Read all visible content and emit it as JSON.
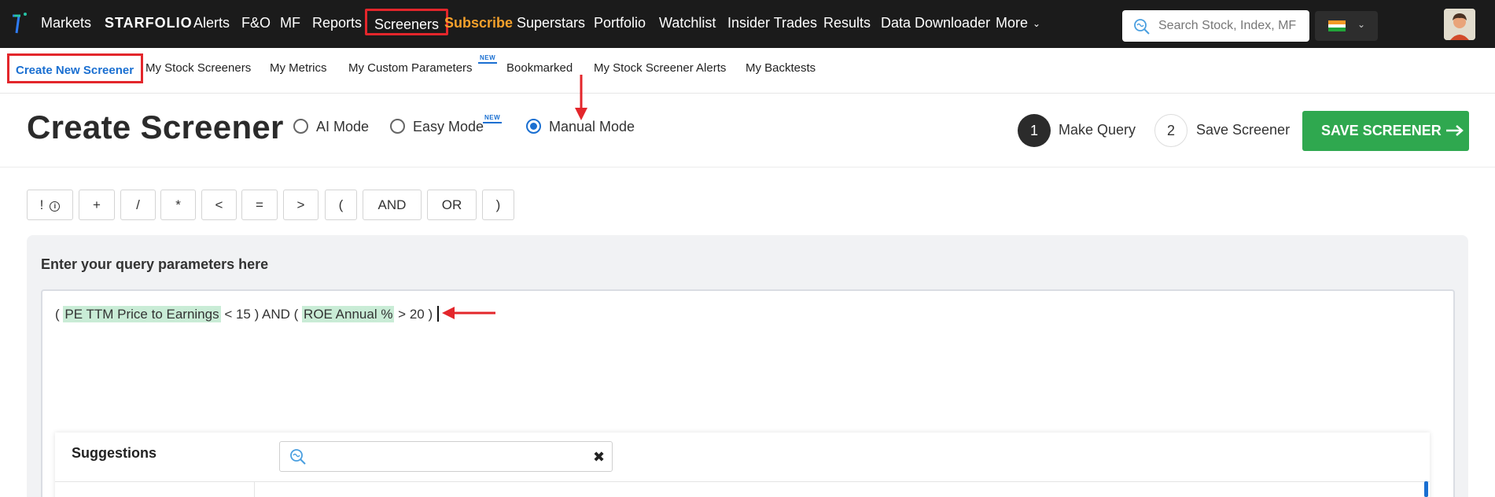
{
  "topnav": {
    "items": [
      {
        "label": "Markets"
      },
      {
        "label": "STARFOLIO"
      },
      {
        "label": "Alerts"
      },
      {
        "label": "F&O"
      },
      {
        "label": "MF"
      },
      {
        "label": "Reports"
      },
      {
        "label": "Screeners"
      },
      {
        "label": "Subscribe"
      },
      {
        "label": "Superstars"
      },
      {
        "label": "Portfolio"
      },
      {
        "label": "Watchlist"
      },
      {
        "label": "Insider Trades"
      },
      {
        "label": "Results"
      },
      {
        "label": "Data Downloader"
      },
      {
        "label": "More"
      }
    ],
    "search_placeholder": "Search Stock, Index, MF",
    "accent_subscribe": "#f5a12b"
  },
  "subnav": {
    "items": [
      {
        "label": "Create New Screener"
      },
      {
        "label": "My Stock Screeners"
      },
      {
        "label": "My Metrics"
      },
      {
        "label": "My Custom Parameters"
      },
      {
        "label": "Bookmarked"
      },
      {
        "label": "My Stock Screener Alerts"
      },
      {
        "label": "My Backtests"
      }
    ],
    "new_badge": "NEW"
  },
  "header": {
    "title": "Create Screener",
    "modes": [
      {
        "label": "AI Mode",
        "selected": false
      },
      {
        "label": "Easy Mode",
        "selected": false
      },
      {
        "label": "Manual Mode",
        "selected": true
      }
    ],
    "new_badge": "NEW",
    "steps": [
      {
        "number": "1",
        "label": "Make Query"
      },
      {
        "number": "2",
        "label": "Save Screener"
      }
    ],
    "save_button": "SAVE SCREENER"
  },
  "operators": [
    "!",
    "+",
    "/",
    "*",
    "<",
    "=",
    ">",
    "(",
    "AND",
    "OR",
    ")"
  ],
  "query": {
    "panel_title": "Enter your query parameters here",
    "tokens": [
      {
        "text": "( ",
        "highlight": false
      },
      {
        "text": "PE TTM Price to Earnings",
        "highlight": true
      },
      {
        "text": " < 15 ) AND ( ",
        "highlight": false
      },
      {
        "text": "ROE Annual %",
        "highlight": true
      },
      {
        "text": " > 20 )",
        "highlight": false
      }
    ]
  },
  "suggestions": {
    "title": "Suggestions",
    "search_value": ""
  },
  "colors": {
    "nav_bg": "#1b1b1b",
    "primary_blue": "#1a6fd1",
    "save_green": "#2fa84f",
    "annotation_red": "#e3262b",
    "highlight_green": "#c9ecd6"
  }
}
